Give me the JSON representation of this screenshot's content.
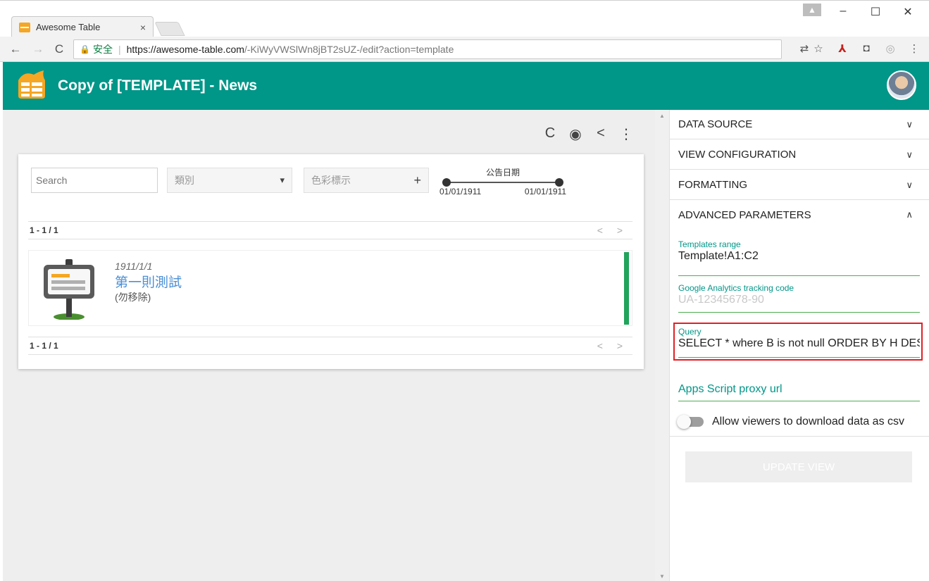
{
  "browser": {
    "tab_title": "Awesome Table",
    "tab_close": "×",
    "window_controls": {
      "minimize": "–",
      "maximize": "☐",
      "close": "✕"
    },
    "nav": {
      "back": "←",
      "forward": "→",
      "reload": "C"
    },
    "address": {
      "lock": "🔒",
      "secure_label": "安全",
      "separator": "|",
      "host": "https://awesome-table.com",
      "path": "/-KiWyVWSlWn8jBT2sUZ-/edit?action=template"
    },
    "extensions": [
      "translate-icon",
      "star-icon",
      "pdf-icon",
      "camera-icon",
      "extension-icon",
      "menu-icon"
    ]
  },
  "app": {
    "title": "Copy of [TEMPLATE] - News",
    "colors": {
      "appbar": "#009688",
      "accent": "#4caf50",
      "link": "#4a8fd6",
      "bar": "#21a45b",
      "highlight": "#e31e24"
    }
  },
  "view": {
    "actions": {
      "reload": "C",
      "preview": "◉",
      "share": "<",
      "more": "⋮"
    },
    "filters": {
      "search_placeholder": "Search",
      "category_label": "類別",
      "category_chevron": "▾",
      "color_label": "色彩標示",
      "color_plus": "+",
      "date_label": "公告日期",
      "date_from": "01/01/1911",
      "date_to": "01/01/1911"
    },
    "pager_top": "1 - 1 / 1",
    "pager_bottom": "1 - 1 / 1",
    "pager_arrows": "< >",
    "entry": {
      "date": "1911/1/1",
      "headline": "第一則測試",
      "sub": "(勿移除)"
    }
  },
  "panel": {
    "sections": [
      {
        "label": "DATA SOURCE",
        "chevron": "∨"
      },
      {
        "label": "VIEW CONFIGURATION",
        "chevron": "∨"
      },
      {
        "label": "FORMATTING",
        "chevron": "∨"
      },
      {
        "label": "ADVANCED PARAMETERS",
        "chevron": "∧"
      }
    ],
    "fields": {
      "templates_range": {
        "label": "Templates range",
        "value": "Template!A1:C2"
      },
      "ga_code": {
        "label": "Google Analytics tracking code",
        "placeholder": "UA-12345678-90"
      },
      "query": {
        "label": "Query",
        "value": "SELECT * where B is not null ORDER BY H DESC"
      },
      "proxy_url": {
        "label": "Apps Script proxy url"
      }
    },
    "csv_toggle_label": "Allow viewers to download data as csv",
    "csv_toggle_on": false,
    "update_button": "UPDATE VIEW"
  }
}
